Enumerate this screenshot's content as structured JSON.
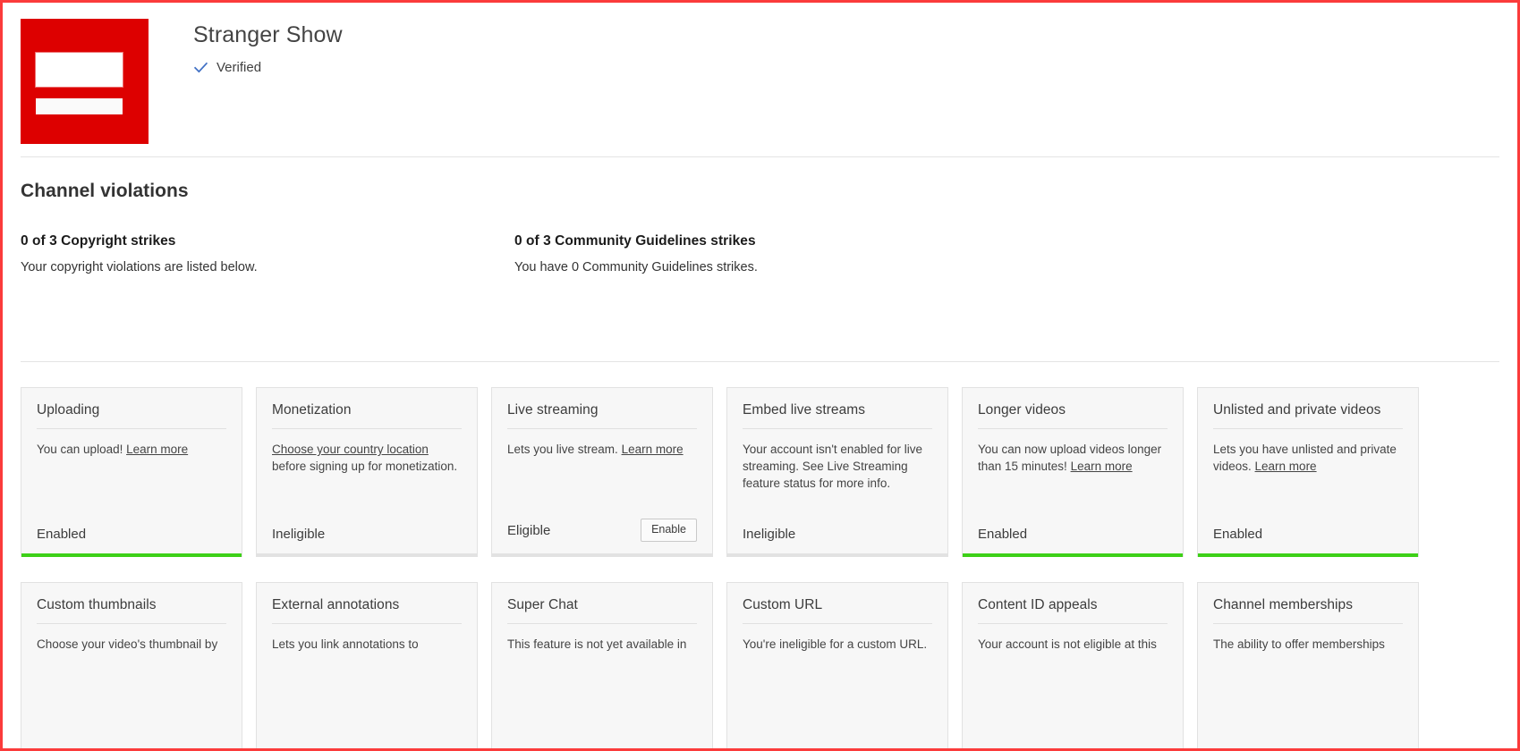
{
  "channel": {
    "name": "Stranger Show",
    "verified_label": "Verified",
    "verified_icon": "check-icon",
    "avatar_color": "#dd0000"
  },
  "violations": {
    "title": "Channel violations",
    "items": [
      {
        "heading": "0 of 3 Copyright strikes",
        "description": "Your copyright violations are listed below."
      },
      {
        "heading": "0 of 3 Community Guidelines strikes",
        "description": "You have 0 Community Guidelines strikes."
      }
    ]
  },
  "colors": {
    "accent_enabled": "#3dd017",
    "accent_disabled": "#e2e2e2",
    "brand_red": "#dd0000",
    "verified_blue": "#3f6fc4",
    "viewport_border": "#fb3b3b"
  },
  "features": {
    "row1": [
      {
        "title": "Uploading",
        "desc_before": "You can upload! ",
        "link": "Learn more",
        "desc_after": "",
        "status": "Enabled",
        "accent": "on",
        "button": null
      },
      {
        "title": "Monetization",
        "desc_before": "",
        "link": "Choose your country location",
        "desc_after": " before signing up for monetization.",
        "status": "Ineligible",
        "accent": "off",
        "button": null
      },
      {
        "title": "Live streaming",
        "desc_before": "Lets you live stream. ",
        "link": "Learn more",
        "desc_after": "",
        "status": "Eligible",
        "accent": "off",
        "button": "Enable"
      },
      {
        "title": "Embed live streams",
        "desc_before": "Your account isn't enabled for live streaming. See Live Streaming feature status for more info.",
        "link": "",
        "desc_after": "",
        "status": "Ineligible",
        "accent": "off",
        "button": null
      },
      {
        "title": "Longer videos",
        "desc_before": "You can now upload videos longer than 15 minutes! ",
        "link": "Learn more",
        "desc_after": "",
        "status": "Enabled",
        "accent": "on",
        "button": null
      },
      {
        "title": "Unlisted and private videos",
        "desc_before": "Lets you have unlisted and private videos. ",
        "link": "Learn more",
        "desc_after": "",
        "status": "Enabled",
        "accent": "on",
        "button": null
      }
    ],
    "row2": [
      {
        "title": "Custom thumbnails",
        "desc_before": "Choose your video's thumbnail by",
        "link": "",
        "desc_after": ""
      },
      {
        "title": "External annotations",
        "desc_before": "Lets you link annotations to",
        "link": "",
        "desc_after": ""
      },
      {
        "title": "Super Chat",
        "desc_before": "This feature is not yet available in",
        "link": "",
        "desc_after": ""
      },
      {
        "title": "Custom URL",
        "desc_before": "You're ineligible for a custom URL.",
        "link": "",
        "desc_after": ""
      },
      {
        "title": "Content ID appeals",
        "desc_before": "Your account is not eligible at this",
        "link": "",
        "desc_after": ""
      },
      {
        "title": "Channel memberships",
        "desc_before": "The ability to offer memberships",
        "link": "",
        "desc_after": ""
      }
    ]
  }
}
